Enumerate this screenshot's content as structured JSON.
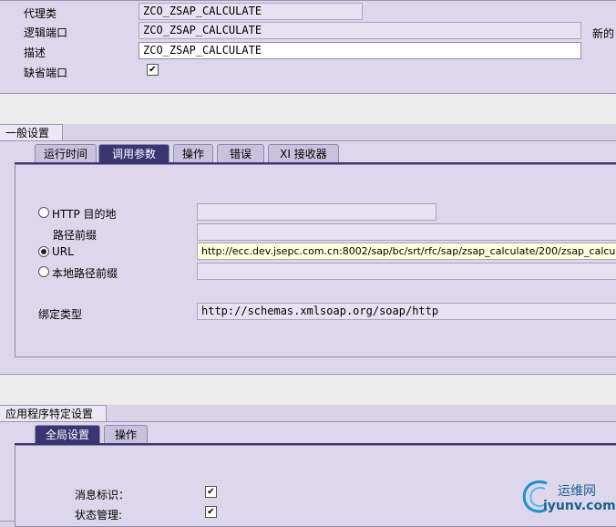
{
  "header": {
    "proxy_class_label": "代理类",
    "proxy_class_value": "ZCO_ZSAP_CALCULATE",
    "logical_port_label": "逻辑端口",
    "logical_port_value": "ZCO_ZSAP_CALCULATE",
    "description_label": "描述",
    "description_value": "ZCO_ZSAP_CALCULATE",
    "default_port_label": "缺省端口",
    "default_port_checked": true,
    "new_label": "新的"
  },
  "general_settings": {
    "title": "一般设置",
    "tabs": [
      "运行时间",
      "调用参数",
      "操作",
      "错误",
      "XI 接收器"
    ],
    "active_tab": 1,
    "http_destination_label": "HTTP 目的地",
    "http_destination_value": "",
    "path_prefix_label": "路径前缀",
    "path_prefix_value": "",
    "url_label": "URL",
    "url_value": "http://ecc.dev.jsepc.com.cn:8002/sap/bc/srt/rfc/sap/zsap_calculate/200/zsap_calcu",
    "local_path_prefix_label": "本地路径前缀",
    "local_path_prefix_value": "",
    "selected_option": "URL",
    "binding_type_label": "绑定类型",
    "binding_type_value": "http://schemas.xmlsoap.org/soap/http"
  },
  "app_settings": {
    "title": "应用程序特定设置",
    "tabs": [
      "全局设置",
      "操作"
    ],
    "active_tab": 0,
    "message_id_label": "消息标识：",
    "message_id_checked": true,
    "state_mgmt_label": "状态管理:",
    "state_mgmt_checked": true
  },
  "watermark": {
    "cn": "运维网",
    "en": "iyunv.com"
  }
}
